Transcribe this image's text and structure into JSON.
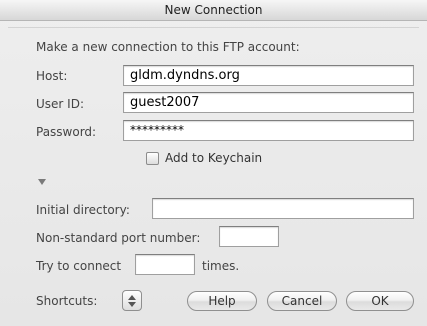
{
  "window": {
    "title": "New Connection"
  },
  "intro": "Make a new connection to this FTP account:",
  "fields": {
    "host": {
      "label": "Host:",
      "value": "gldm.dyndns.org"
    },
    "user_id": {
      "label": "User ID:",
      "value": "guest2007"
    },
    "password": {
      "label": "Password:",
      "value": "*********"
    }
  },
  "keychain": {
    "label": "Add to Keychain",
    "checked": false
  },
  "advanced": {
    "initial_directory": {
      "label": "Initial directory:",
      "value": ""
    },
    "port": {
      "label": "Non-standard port number:",
      "value": ""
    },
    "retry": {
      "prefix": "Try to connect",
      "value": "",
      "suffix": "times."
    }
  },
  "footer": {
    "shortcuts_label": "Shortcuts:",
    "help_label": "Help",
    "cancel_label": "Cancel",
    "ok_label": "OK"
  }
}
